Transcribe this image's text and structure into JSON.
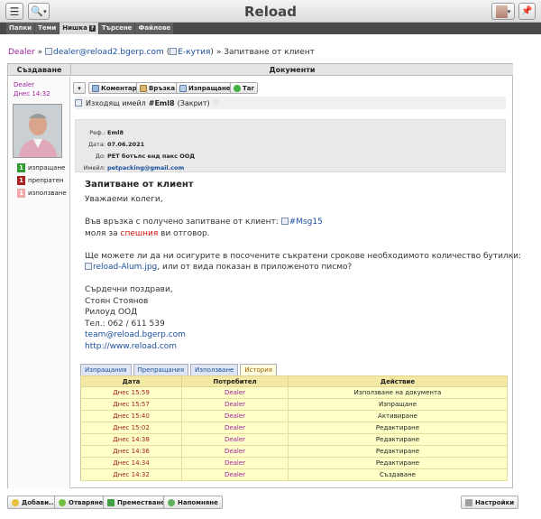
{
  "app": {
    "title": "Reload"
  },
  "nav_tabs": [
    {
      "label": "Папки"
    },
    {
      "label": "Теми"
    },
    {
      "label": "Нишка"
    },
    {
      "label": "Търсене"
    },
    {
      "label": "Файлове"
    }
  ],
  "breadcrumb": {
    "user": "Dealer",
    "sep1": "»",
    "email": "dealer@reload2.bgerp.com",
    "paren_open": "(",
    "inbox": "Е-кутия",
    "paren_close": ")",
    "sep2": "»",
    "current": "Запитване от клиент"
  },
  "columns": {
    "left": "Създаване",
    "right": "Документи"
  },
  "author": {
    "name": "Dealer",
    "date": "Днес 14:32",
    "stats": [
      {
        "count": "1",
        "label": "изпращане",
        "color": "#2e9a2e"
      },
      {
        "count": "1",
        "label": "препратен",
        "color": "#a82020"
      },
      {
        "count": "1",
        "label": "използване",
        "color": "#f0a8a8"
      }
    ]
  },
  "toolbar": {
    "comment": "Коментар",
    "link": "Връзка",
    "send": "Изпращане",
    "tag": "Таг"
  },
  "document": {
    "title_prefix": "Изходящ имейл",
    "ref": "#Eml8",
    "status": "(Закрит)",
    "meta": [
      {
        "label": "Реф.:",
        "value": "Eml8"
      },
      {
        "label": "Дата:",
        "value": "07.06.2021"
      },
      {
        "label": "До:",
        "value": "PET ботълс енд пакс ООД"
      },
      {
        "label": "Имейл:",
        "value": "petpacking@gmail.com"
      }
    ],
    "subject": "Запитване от клиент",
    "body": {
      "greeting": "Уважаеми колеги,",
      "line1": "Във връзка с получено запитване от клиент:",
      "msg_link": "#Msg15",
      "line2a": "моля за",
      "urgent": "спешния",
      "line2b": "ви отговор.",
      "line3": "Ще можете ли да ни осигурите в посочените съкратени срокове необходимото количество бутилки:",
      "file_link": "reload-Alum.jpg",
      "line4": ", или от вида показан в приложеното писмо?",
      "regards": "Сърдечни поздрави,",
      "sig_name": "Стоян Стоянов",
      "sig_company": "Рилоуд ООД",
      "sig_phone": "Тел.: 062 / 611 539",
      "sig_email": "team@reload.bgerp.com",
      "sig_web": "http://www.reload.com"
    }
  },
  "history_tabs": [
    {
      "label": "Изпращания"
    },
    {
      "label": "Препращания"
    },
    {
      "label": "Използване"
    },
    {
      "label": "История"
    }
  ],
  "history": {
    "headers": {
      "date": "Дата",
      "user": "Потребител",
      "action": "Действие"
    },
    "rows": [
      {
        "date": "Днес 15:59",
        "user": "Dealer",
        "action": "Използване на документа"
      },
      {
        "date": "Днес 15:57",
        "user": "Dealer",
        "action": "Изпращане"
      },
      {
        "date": "Днес 15:40",
        "user": "Dealer",
        "action": "Активиране"
      },
      {
        "date": "Днес 15:02",
        "user": "Dealer",
        "action": "Редактиране"
      },
      {
        "date": "Днес 14:38",
        "user": "Dealer",
        "action": "Редактиране"
      },
      {
        "date": "Днес 14:36",
        "user": "Dealer",
        "action": "Редактиране"
      },
      {
        "date": "Днес 14:34",
        "user": "Dealer",
        "action": "Редактиране"
      },
      {
        "date": "Днес 14:32",
        "user": "Dealer",
        "action": "Създаване"
      }
    ]
  },
  "footer": {
    "add": "Добави...",
    "open": "Отваряне",
    "move": "Преместване",
    "remind": "Напомняне",
    "settings": "Настройки"
  }
}
